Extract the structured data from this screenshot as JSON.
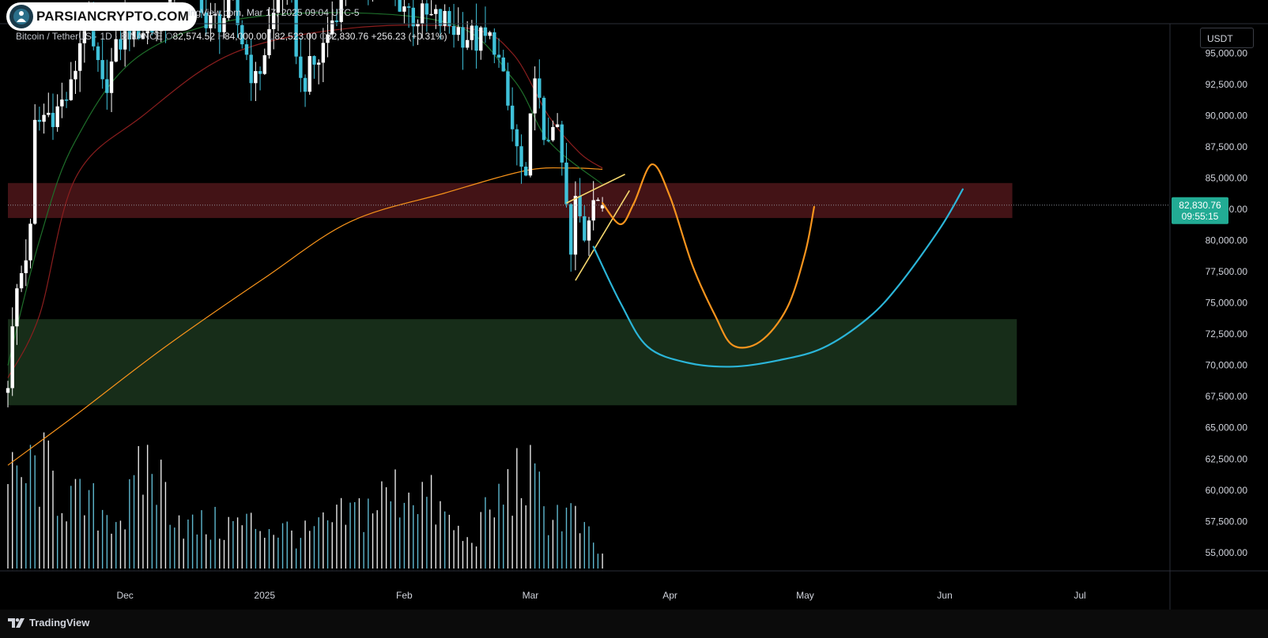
{
  "header": {
    "brand": "PARSIANCRYPTO.COM",
    "published_line": "ingView.com, Mar 17, 2025 09:04 UTC-5"
  },
  "legend": {
    "symbol": "Bitcoin / TetherUS · 1D · BINANCE",
    "open_key": "O",
    "open": "82,574.52",
    "high_key": "H",
    "high": "84,000.00",
    "low_key": "L",
    "low": "82,523.00",
    "close_key": "C",
    "close": "82,830.76",
    "change": "+256.23 (+0.31%)"
  },
  "currency_button": "USDT",
  "price_tag": {
    "price": "82,830.76",
    "countdown": "09:55:15",
    "color": "#22ab94"
  },
  "footer": {
    "brand": "TradingView"
  },
  "colors": {
    "background": "#000000",
    "resistance_zone": "#4a1518",
    "support_zone": "#19321c",
    "candle_up": "#ffffff",
    "candle_down": "#3fc1d9",
    "ema_200": "#f7931a",
    "ma_red": "#8b1e1e",
    "ma_green": "#1e6e2a",
    "projection_orange": "#f7941d",
    "projection_blue": "#2bb5d8",
    "wedge": "#f5d76e"
  },
  "chart_data": {
    "type": "candlestick",
    "symbol": "BTCUSDT",
    "timeframe": "1D",
    "y_axis": {
      "min": 53600,
      "max": 97300,
      "ticks": [
        55000,
        57500,
        60000,
        62500,
        65000,
        67500,
        70000,
        72500,
        75000,
        77500,
        80000,
        82500,
        85000,
        87500,
        90000,
        92500,
        95000
      ],
      "tick_labels": [
        "55,000.00",
        "57,500.00",
        "60,000.00",
        "62,500.00",
        "65,000.00",
        "67,500.00",
        "70,000.00",
        "72,500.00",
        "75,000.00",
        "77,500.00",
        "80,000.00",
        "82,500.00",
        "85,000.00",
        "87,500.00",
        "90,000.00",
        "92,500.00",
        "95,000.00"
      ]
    },
    "x_axis": {
      "start": "2024-11-05",
      "end": "2025-07-21",
      "tick_labels": [
        {
          "date": "2024-12-01",
          "label": "Dec"
        },
        {
          "date": "2025-01-01",
          "label": "2025"
        },
        {
          "date": "2025-02-01",
          "label": "Feb"
        },
        {
          "date": "2025-03-01",
          "label": "Mar"
        },
        {
          "date": "2025-04-01",
          "label": "Apr"
        },
        {
          "date": "2025-05-01",
          "label": "May"
        },
        {
          "date": "2025-06-01",
          "label": "Jun"
        },
        {
          "date": "2025-07-01",
          "label": "Jul"
        }
      ]
    },
    "last_price": 82830.76,
    "zones": [
      {
        "name": "resistance",
        "from": "2024-11-05",
        "to": "2025-06-16",
        "low": 81800,
        "high": 84600
      },
      {
        "name": "support",
        "from": "2024-11-05",
        "to": "2025-06-17",
        "low": 66800,
        "high": 73700
      }
    ],
    "close_anchors": [
      {
        "date": "2024-11-05",
        "close": 69000
      },
      {
        "date": "2024-11-07",
        "close": 76000
      },
      {
        "date": "2024-11-10",
        "close": 80500
      },
      {
        "date": "2024-11-11",
        "close": 89000
      },
      {
        "date": "2024-11-13",
        "close": 90000
      },
      {
        "date": "2024-11-16",
        "close": 90500
      },
      {
        "date": "2024-11-19",
        "close": 92000
      },
      {
        "date": "2024-11-22",
        "close": 98000
      },
      {
        "date": "2024-11-26",
        "close": 92000
      },
      {
        "date": "2024-12-01",
        "close": 97000
      },
      {
        "date": "2024-12-05",
        "close": 97000
      },
      {
        "date": "2024-12-09",
        "close": 97000
      },
      {
        "date": "2024-12-16",
        "close": 104000
      },
      {
        "date": "2024-12-19",
        "close": 97000
      },
      {
        "date": "2024-12-25",
        "close": 98500
      },
      {
        "date": "2024-12-30",
        "close": 92500
      },
      {
        "date": "2025-01-03",
        "close": 98000
      },
      {
        "date": "2025-01-06",
        "close": 102000
      },
      {
        "date": "2025-01-09",
        "close": 92500
      },
      {
        "date": "2025-01-13",
        "close": 94500
      },
      {
        "date": "2025-01-20",
        "close": 102000
      },
      {
        "date": "2025-01-27",
        "close": 101000
      },
      {
        "date": "2025-02-03",
        "close": 98000
      },
      {
        "date": "2025-02-10",
        "close": 97500
      },
      {
        "date": "2025-02-17",
        "close": 96000
      },
      {
        "date": "2025-02-21",
        "close": 96000
      },
      {
        "date": "2025-02-25",
        "close": 88800
      },
      {
        "date": "2025-02-28",
        "close": 84000
      },
      {
        "date": "2025-03-02",
        "close": 94200
      },
      {
        "date": "2025-03-04",
        "close": 87000
      },
      {
        "date": "2025-03-06",
        "close": 90000
      },
      {
        "date": "2025-03-08",
        "close": 86000
      },
      {
        "date": "2025-03-10",
        "close": 78600
      },
      {
        "date": "2025-03-11",
        "close": 82900
      },
      {
        "date": "2025-03-13",
        "close": 80500
      },
      {
        "date": "2025-03-15",
        "close": 84300
      },
      {
        "date": "2025-03-17",
        "close": 82830.76
      }
    ],
    "moving_averages": [
      {
        "color_key": "ema_200",
        "points": [
          [
            "2024-11-05",
            62000
          ],
          [
            "2024-11-20",
            66000
          ],
          [
            "2024-12-10",
            71500
          ],
          [
            "2025-01-01",
            77000
          ],
          [
            "2025-01-20",
            81500
          ],
          [
            "2025-02-10",
            83800
          ],
          [
            "2025-02-28",
            85600
          ],
          [
            "2025-03-10",
            85800
          ],
          [
            "2025-03-17",
            85700
          ]
        ]
      },
      {
        "color_key": "ma_red",
        "points": [
          [
            "2024-11-05",
            69000
          ],
          [
            "2024-11-12",
            74000
          ],
          [
            "2024-11-20",
            85000
          ],
          [
            "2024-12-05",
            90000
          ],
          [
            "2024-12-25",
            95000
          ],
          [
            "2025-01-20",
            97000
          ],
          [
            "2025-02-15",
            97000
          ],
          [
            "2025-02-25",
            95000
          ],
          [
            "2025-03-05",
            90000
          ],
          [
            "2025-03-12",
            87000
          ],
          [
            "2025-03-17",
            85800
          ]
        ]
      },
      {
        "color_key": "ma_green",
        "points": [
          [
            "2024-11-05",
            70000
          ],
          [
            "2024-11-12",
            80000
          ],
          [
            "2024-11-20",
            88000
          ],
          [
            "2024-12-05",
            95000
          ],
          [
            "2025-01-01",
            98000
          ],
          [
            "2025-02-10",
            97500
          ],
          [
            "2025-02-25",
            93000
          ],
          [
            "2025-03-05",
            88000
          ],
          [
            "2025-03-17",
            84500
          ]
        ]
      }
    ],
    "drawings": [
      {
        "type": "line",
        "color_key": "wedge",
        "from": [
          "2025-03-09",
          83000
        ],
        "to": [
          "2025-03-22",
          85300
        ]
      },
      {
        "type": "line",
        "color_key": "wedge",
        "from": [
          "2025-03-11",
          76800
        ],
        "to": [
          "2025-03-23",
          84000
        ]
      },
      {
        "type": "curve",
        "color_key": "projection_orange",
        "points": [
          [
            "2025-03-17",
            83000
          ],
          [
            "2025-03-21",
            81300
          ],
          [
            "2025-03-24",
            83000
          ],
          [
            "2025-03-28",
            86100
          ],
          [
            "2025-04-01",
            83500
          ],
          [
            "2025-04-06",
            78000
          ],
          [
            "2025-04-11",
            74000
          ],
          [
            "2025-04-15",
            71600
          ],
          [
            "2025-04-21",
            71900
          ],
          [
            "2025-04-27",
            74600
          ],
          [
            "2025-05-01",
            79000
          ],
          [
            "2025-05-03",
            82700
          ]
        ]
      },
      {
        "type": "curve",
        "color_key": "projection_blue",
        "points": [
          [
            "2025-03-15",
            79500
          ],
          [
            "2025-03-21",
            75000
          ],
          [
            "2025-03-27",
            71500
          ],
          [
            "2025-04-05",
            70200
          ],
          [
            "2025-04-15",
            69900
          ],
          [
            "2025-04-25",
            70400
          ],
          [
            "2025-05-05",
            71400
          ],
          [
            "2025-05-15",
            73800
          ],
          [
            "2025-05-22",
            76500
          ],
          [
            "2025-05-31",
            81000
          ],
          [
            "2025-06-05",
            84100
          ]
        ]
      }
    ],
    "volume_anchors": [
      {
        "date": "2024-11-05",
        "level": 0.68
      },
      {
        "date": "2024-11-12",
        "level": 0.85
      },
      {
        "date": "2024-11-20",
        "level": 0.55
      },
      {
        "date": "2024-12-01",
        "level": 0.45
      },
      {
        "date": "2024-12-06",
        "level": 0.9
      },
      {
        "date": "2024-12-15",
        "level": 0.35
      },
      {
        "date": "2024-12-30",
        "level": 0.38
      },
      {
        "date": "2025-01-10",
        "level": 0.28
      },
      {
        "date": "2025-01-20",
        "level": 0.45
      },
      {
        "date": "2025-02-03",
        "level": 0.72
      },
      {
        "date": "2025-02-15",
        "level": 0.22
      },
      {
        "date": "2025-02-25",
        "level": 0.72
      },
      {
        "date": "2025-02-28",
        "level": 0.8
      },
      {
        "date": "2025-03-05",
        "level": 0.48
      },
      {
        "date": "2025-03-10",
        "level": 0.45
      },
      {
        "date": "2025-03-17",
        "level": 0.1
      }
    ]
  }
}
